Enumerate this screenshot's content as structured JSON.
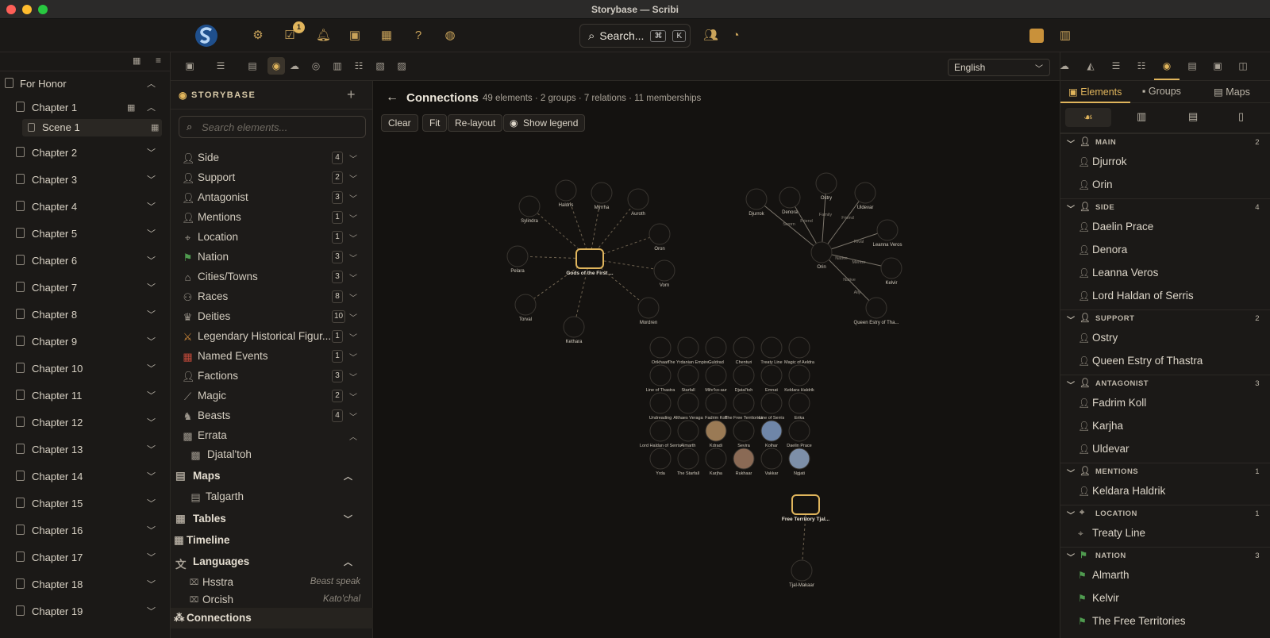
{
  "window": {
    "title": "Storybase — Scribi"
  },
  "topbar": {
    "search_label": "Search...",
    "kbd1": "⌘",
    "kbd2": "K",
    "badge": "1"
  },
  "leftnav": {
    "book": "For Honor",
    "chapter1": "Chapter 1",
    "scene1": "Scene 1",
    "chapters": [
      "Chapter 2",
      "Chapter 3",
      "Chapter 4",
      "Chapter 5",
      "Chapter 6",
      "Chapter 7",
      "Chapter 8",
      "Chapter 9",
      "Chapter 10",
      "Chapter 11",
      "Chapter 12",
      "Chapter 13",
      "Chapter 14",
      "Chapter 15",
      "Chapter 16",
      "Chapter 17",
      "Chapter 18",
      "Chapter 19"
    ]
  },
  "storybase": {
    "header": "STORYBASE",
    "search_placeholder": "Search elements...",
    "categories": [
      {
        "label": "Side",
        "count": "4",
        "icon": "person-icon"
      },
      {
        "label": "Support",
        "count": "2",
        "icon": "person-icon"
      },
      {
        "label": "Antagonist",
        "count": "3",
        "icon": "person-icon"
      },
      {
        "label": "Mentions",
        "count": "1",
        "icon": "person-icon"
      },
      {
        "label": "Location",
        "count": "1",
        "icon": "map-pin-icon"
      },
      {
        "label": "Nation",
        "count": "3",
        "icon": "flag-icon"
      },
      {
        "label": "Cities/Towns",
        "count": "3",
        "icon": "house-icon"
      },
      {
        "label": "Races",
        "count": "8",
        "icon": "people-icon"
      },
      {
        "label": "Deities",
        "count": "10",
        "icon": "crown-icon"
      },
      {
        "label": "Legendary Historical Figur...",
        "count": "1",
        "icon": "sword-icon"
      },
      {
        "label": "Named Events",
        "count": "1",
        "icon": "calendar-icon"
      },
      {
        "label": "Factions",
        "count": "3",
        "icon": "person-icon"
      },
      {
        "label": "Magic",
        "count": "2",
        "icon": "wand-icon"
      },
      {
        "label": "Beasts",
        "count": "4",
        "icon": "horse-icon"
      }
    ],
    "errata": "Errata",
    "errata_item": "Djatal'toh",
    "maps": "Maps",
    "map_item": "Talgarth",
    "tables": "Tables",
    "timeline": "Timeline",
    "languages": "Languages",
    "lang1": "Hsstra",
    "lang1_note": "Beast speak",
    "lang2": "Orcish",
    "lang2_note": "Kato'chal",
    "connections": "Connections"
  },
  "toolbar": {
    "language": "English"
  },
  "canvas": {
    "title": "Connections",
    "stats": "49 elements · 2 groups · 7 relations · 11 memberships",
    "buttons": {
      "clear": "Clear",
      "fit": "Fit",
      "relayout": "Re-layout",
      "legend": "Show legend"
    },
    "group1": {
      "name": "Gods of the First ...",
      "members": [
        "Sylindra",
        "Haldris",
        "Myrrha",
        "Auroth",
        "Oron",
        "Vorn",
        "Mordren",
        "Kethara",
        "Torval",
        "Pelara"
      ]
    },
    "group2": {
      "name": "Free Territory Tjal...",
      "member": "Tjal-Makaar"
    },
    "orin_net": {
      "center": "Orin",
      "nodes": [
        "Djurrok",
        "Denora",
        "Ostry",
        "Uldevar",
        "Leanna Veros",
        "Kelvir",
        "Queen Estry of Tha..."
      ],
      "edges": [
        "Sworn",
        "Friend",
        "Family",
        "Friend",
        "Rival",
        "Mentor",
        "Native",
        "Native",
        "Ally"
      ]
    },
    "grid": [
      [
        "Orikhaan",
        "The Yrdanian Empire",
        "Guldrad",
        "Chenturi",
        "Treaty Line",
        "Magic of Aeldra"
      ],
      [
        "Line of Thastra",
        "Starfall",
        "Mihr'ko-aur",
        "Djatal'toh",
        "Emnat",
        "Keldara Haldrik"
      ],
      [
        "Undreading",
        "Althaes Veraga",
        "Fadrim Koll",
        "The Free Territories",
        "Line of Serris",
        "Erika"
      ],
      [
        "Lord Haldan of Serris",
        "Almarth",
        "Kdradi",
        "Sevira",
        "Kolhar",
        "Daelin Prace"
      ],
      [
        "Yrda",
        "The Starfall",
        "Karjha",
        "Rukhaar",
        "Vakkar",
        "Ngjati"
      ]
    ]
  },
  "rpanel": {
    "tabs": [
      "Elements",
      "Groups",
      "Maps"
    ],
    "groups": [
      {
        "name": "MAIN",
        "count": "2",
        "icon": "person-icon",
        "items": [
          "Djurrok",
          "Orin"
        ]
      },
      {
        "name": "SIDE",
        "count": "4",
        "icon": "person-icon",
        "items": [
          "Daelin Prace",
          "Denora",
          "Leanna Veros",
          "Lord Haldan of Serris"
        ]
      },
      {
        "name": "SUPPORT",
        "count": "2",
        "icon": "person-icon",
        "items": [
          "Ostry",
          "Queen Estry of Thastra"
        ]
      },
      {
        "name": "ANTAGONIST",
        "count": "3",
        "icon": "person-icon",
        "items": [
          "Fadrim Koll",
          "Karjha",
          "Uldevar"
        ]
      },
      {
        "name": "MENTIONS",
        "count": "1",
        "icon": "person-icon",
        "items": [
          "Keldara Haldrik"
        ]
      },
      {
        "name": "LOCATION",
        "count": "1",
        "icon": "map-pin-icon",
        "items": [
          "Treaty Line"
        ]
      },
      {
        "name": "NATION",
        "count": "3",
        "icon": "flag-icon",
        "items": [
          "Almarth",
          "Kelvir",
          "The Free Territories"
        ]
      }
    ]
  },
  "colors": {
    "accent": "#e0b55c",
    "bg": "#181614",
    "panel": "#1d1b19"
  }
}
